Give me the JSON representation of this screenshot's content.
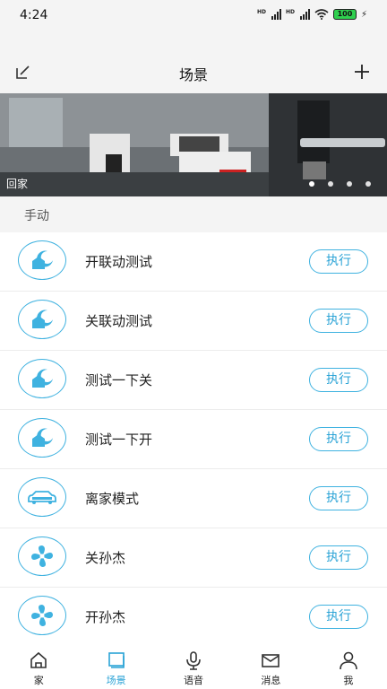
{
  "status_bar": {
    "time": "4:24",
    "battery": "100",
    "signal_badge": "HD"
  },
  "header": {
    "title": "场景",
    "edit_icon": "edit-icon",
    "add_icon": "plus-icon"
  },
  "banner": {
    "caption": "回家",
    "page_count": 4,
    "active_page": 1
  },
  "section": {
    "label": "手动"
  },
  "accent_color": "#3fb2e0",
  "scenes": [
    {
      "name": "开联动测试",
      "icon": "moon-house-icon",
      "action": "执行"
    },
    {
      "name": "关联动测试",
      "icon": "moon-house-icon",
      "action": "执行"
    },
    {
      "name": "测试一下关",
      "icon": "moon-house-icon",
      "action": "执行"
    },
    {
      "name": "测试一下开",
      "icon": "moon-house-icon",
      "action": "执行"
    },
    {
      "name": "离家模式",
      "icon": "car-icon",
      "action": "执行"
    },
    {
      "name": "关孙杰",
      "icon": "fan-icon",
      "action": "执行"
    },
    {
      "name": "开孙杰",
      "icon": "fan-icon",
      "action": "执行"
    }
  ],
  "tabs": [
    {
      "label": "家",
      "icon": "home-icon",
      "active": false
    },
    {
      "label": "场景",
      "icon": "scene-icon",
      "active": true
    },
    {
      "label": "语音",
      "icon": "microphone-icon",
      "active": false
    },
    {
      "label": "消息",
      "icon": "envelope-icon",
      "active": false
    },
    {
      "label": "我",
      "icon": "person-icon",
      "active": false
    }
  ]
}
